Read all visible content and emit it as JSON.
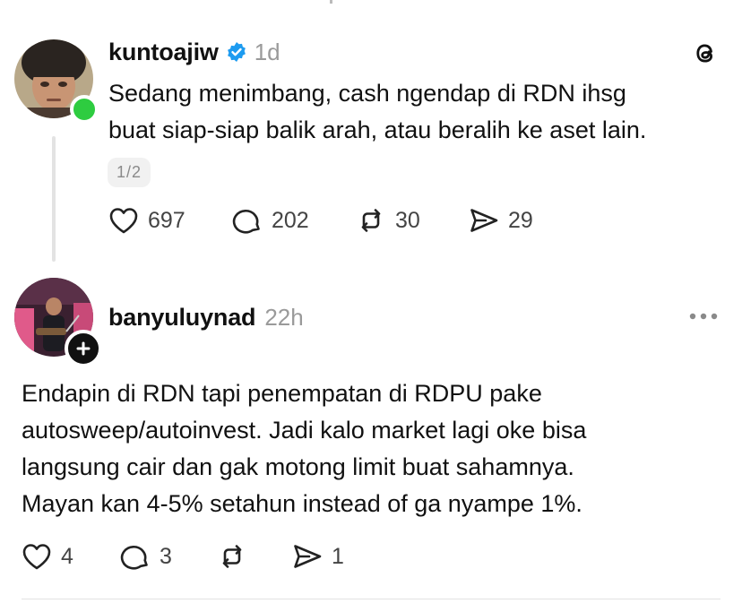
{
  "post1": {
    "username": "kuntoajiw",
    "time": "1d",
    "text_line1": "Sedang menimbang, cash ngendap di RDN ihsg",
    "text_line2": "buat siap-siap balik arah, atau beralih ke aset lain.",
    "pager": "1/2",
    "likes": "697",
    "replies": "202",
    "reposts": "30",
    "shares": "29"
  },
  "post2": {
    "username": "banyuluynad",
    "time": "22h",
    "text_lines": [
      "Endapin di RDN tapi penempatan di RDPU pake",
      "autosweep/autoinvest. Jadi kalo market lagi oke bisa",
      "langsung cair dan gak motong limit buat sahamnya.",
      "Mayan kan 4-5% setahun instead of ga nyampe 1%."
    ],
    "likes": "4",
    "replies": "3",
    "shares": "1"
  },
  "colors": {
    "verified": "#1d9bf0",
    "online": "#2ecc40",
    "muted": "#9a9a9a"
  },
  "icons": [
    "threads-logo-icon",
    "verified-icon",
    "heart-icon",
    "comment-icon",
    "repost-icon",
    "share-icon",
    "more-icon",
    "follow-plus-icon"
  ]
}
